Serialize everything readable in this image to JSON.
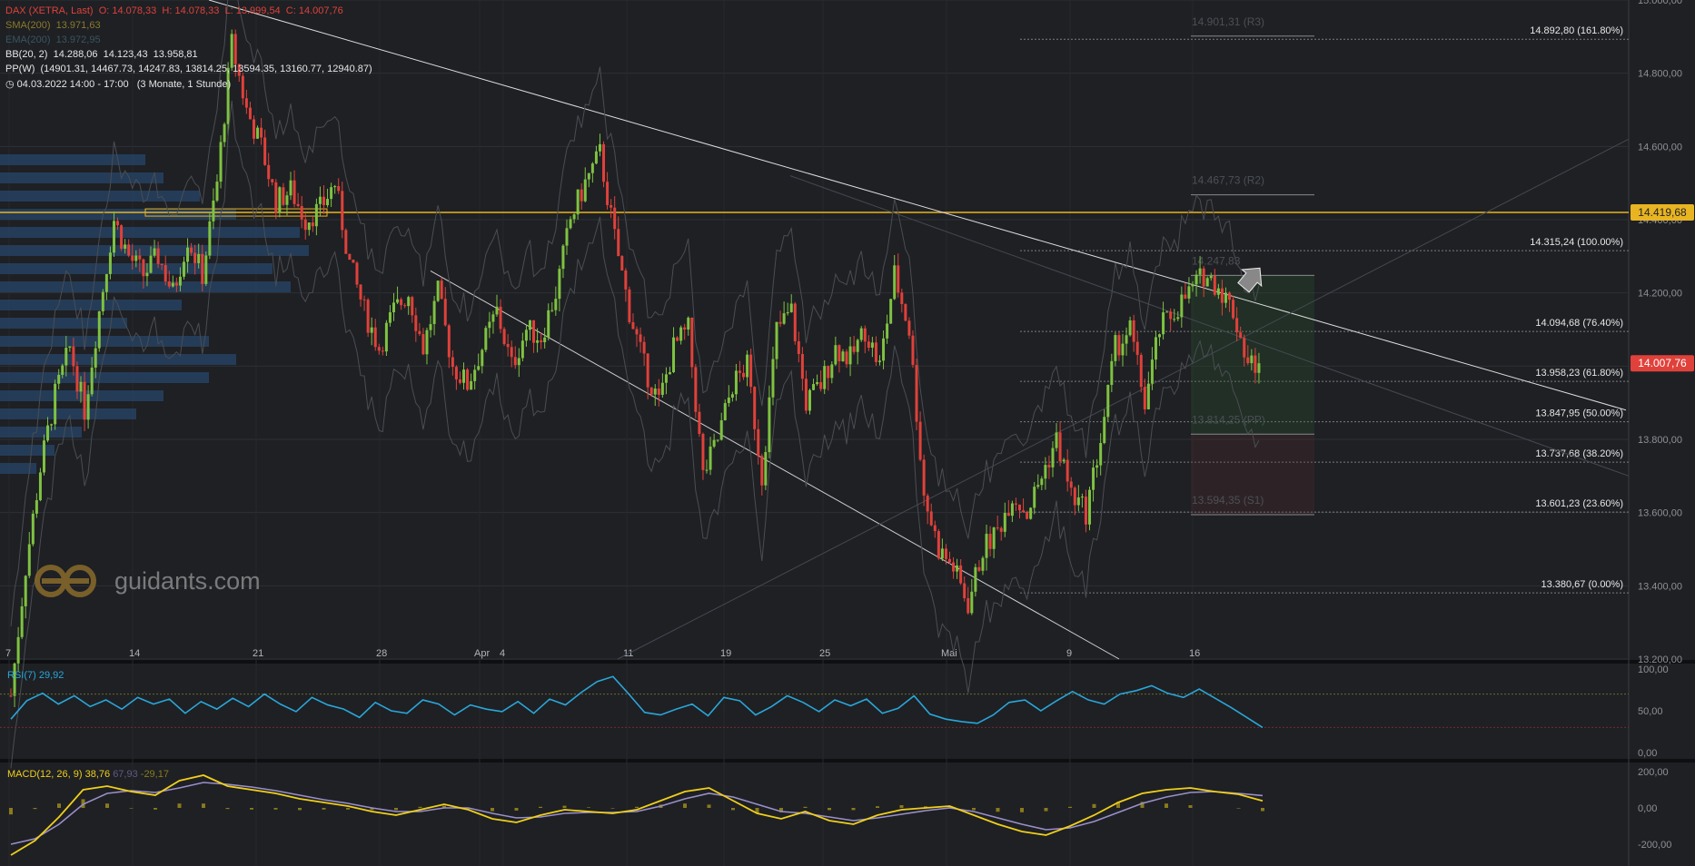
{
  "header": {
    "instrument_line": "DAX (XETRA, Last)  O: 14.078,33  H: 14.078,33  L: 13.999,54  C: 14.007,76",
    "sma_line": "SMA(200)  13.971,63",
    "ema_line": "EMA(200)  13.972,95",
    "bb_line": "BB(20, 2)  14.288,06  14.123,43  13.958,81",
    "pp_line": "PP(W)  (14901.31, 14467.73, 14247.83, 13814.25, 13594.35, 13160.77, 12940.87)",
    "range_line": "04.03.2022 14:00 - 17:00   (3 Monate, 1 Stunde)"
  },
  "watermark": {
    "text": "guidants.com"
  },
  "colors": {
    "background": "#1e2024",
    "up": "#7fc241",
    "down": "#e0413a",
    "accent": "#e8b422",
    "rsi": "#2aa6d8",
    "macd": "#f0cf1a",
    "signal": "#9a8fc8",
    "last_price": "#e0413a"
  },
  "chart_data": [
    {
      "type": "candlestick",
      "title": "DAX (XETRA, Last)",
      "ylim": [
        13200,
        15000
      ],
      "y_ticks": [
        "15.000,00",
        "14.800,00",
        "14.600,00",
        "14.400,00",
        "14.200,00",
        "14.000,00",
        "13.800,00",
        "13.600,00",
        "13.400,00",
        "13.200,00"
      ],
      "x_ticks": [
        "7",
        "14",
        "21",
        "28",
        "Apr",
        "4",
        "11",
        "19",
        "25",
        "Mai",
        "9",
        "16"
      ],
      "price_labels": {
        "last": "14.007,76",
        "level": "14.419,68"
      },
      "fibonacci": [
        {
          "label": "14.892,80 (161.80%)",
          "value": 14892.8
        },
        {
          "label": "14.315,24 (100.00%)",
          "value": 14315.24
        },
        {
          "label": "14.094,68 (76.40%)",
          "value": 14094.68
        },
        {
          "label": "13.958,23 (61.80%)",
          "value": 13958.23
        },
        {
          "label": "13.847,95 (50.00%)",
          "value": 13847.95
        },
        {
          "label": "13.737,68 (38.20%)",
          "value": 13737.68
        },
        {
          "label": "13.601,23 (23.60%)",
          "value": 13601.23
        },
        {
          "label": "13.380,67 (0.00%)",
          "value": 13380.67
        }
      ],
      "pivots": [
        {
          "label": "14.901,31 (R3)",
          "value": 14901.31
        },
        {
          "label": "14.467,73 (R2)",
          "value": 14467.73
        },
        {
          "label": "14.247,83",
          "value": 14247.83
        },
        {
          "label": "13.814,25 (PP)",
          "value": 13814.25
        },
        {
          "label": "13.594,35 (S1)",
          "value": 13594.35
        }
      ],
      "horizontal_level": 14419.68,
      "close_path": [
        13100,
        13450,
        13720,
        13920,
        14050,
        13880,
        14150,
        14400,
        14300,
        14250,
        14300,
        14200,
        14350,
        14250,
        14500,
        14880,
        14700,
        14600,
        14450,
        14480,
        14400,
        14430,
        14500,
        14280,
        14150,
        14050,
        14150,
        14200,
        14050,
        14200,
        14000,
        13950,
        14050,
        14150,
        14000,
        14100,
        14080,
        14200,
        14400,
        14500,
        14580,
        14350,
        14150,
        14000,
        13900,
        14050,
        14100,
        13700,
        13800,
        13950,
        14000,
        13700,
        14100,
        14150,
        13900,
        13950,
        14050,
        14020,
        14100,
        14000,
        14250,
        14100,
        13650,
        13500,
        13450,
        13350,
        13500,
        13550,
        13650,
        13600,
        13700,
        13800,
        13650,
        13600,
        13800,
        14050,
        14100,
        13900,
        14100,
        14150,
        14200,
        14250,
        14220,
        14150,
        14007.76
      ]
    },
    {
      "type": "line",
      "title": "RSI(7)",
      "last_value": "29,92",
      "ylim": [
        0,
        100
      ],
      "y_ticks": [
        "100,00",
        "50,00",
        "0,00"
      ],
      "values": [
        40,
        62,
        71,
        58,
        68,
        55,
        63,
        52,
        66,
        58,
        64,
        47,
        61,
        52,
        65,
        55,
        70,
        58,
        49,
        66,
        57,
        52,
        42,
        60,
        50,
        47,
        63,
        58,
        45,
        57,
        52,
        49,
        61,
        47,
        64,
        57,
        72,
        85,
        91,
        70,
        48,
        45,
        52,
        58,
        44,
        66,
        62,
        45,
        55,
        68,
        60,
        49,
        63,
        56,
        64,
        47,
        53,
        68,
        46,
        40,
        37,
        35,
        45,
        60,
        63,
        50,
        62,
        73,
        63,
        58,
        70,
        74,
        80,
        71,
        66,
        76,
        65,
        54,
        42,
        29.92
      ]
    },
    {
      "type": "line",
      "title": "MACD(12, 26, 9)",
      "last_value": "38,76",
      "signal_value": "67,93",
      "histogram_value": "-29,17",
      "ylim": [
        -300,
        230
      ],
      "y_ticks": [
        "200,00",
        "0,00",
        "-200,00"
      ],
      "macd": [
        -260,
        -180,
        -50,
        100,
        120,
        90,
        70,
        150,
        180,
        120,
        100,
        80,
        50,
        30,
        10,
        -20,
        -40,
        -10,
        20,
        -10,
        -60,
        -80,
        -40,
        -10,
        -20,
        -30,
        -10,
        40,
        90,
        110,
        40,
        -30,
        -60,
        -20,
        -70,
        -90,
        -40,
        -10,
        0,
        10,
        -40,
        -90,
        -130,
        -150,
        -100,
        -40,
        30,
        80,
        100,
        110,
        90,
        75,
        38.76
      ],
      "signal": [
        -200,
        -170,
        -90,
        20,
        80,
        95,
        85,
        110,
        140,
        130,
        115,
        95,
        70,
        45,
        25,
        0,
        -20,
        -20,
        0,
        0,
        -30,
        -55,
        -50,
        -30,
        -25,
        -25,
        -20,
        10,
        50,
        80,
        60,
        20,
        -20,
        -30,
        -50,
        -70,
        -55,
        -35,
        -15,
        0,
        -20,
        -55,
        -90,
        -120,
        -110,
        -75,
        -25,
        25,
        60,
        85,
        90,
        80,
        67.93
      ]
    }
  ]
}
